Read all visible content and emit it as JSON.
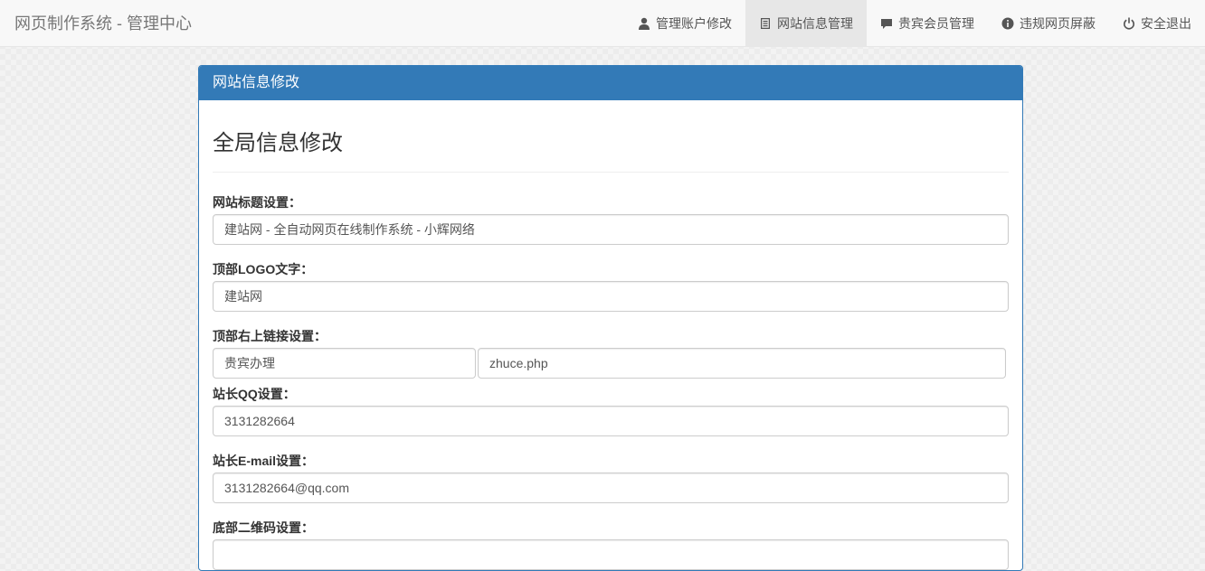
{
  "brand": "网页制作系统 - 管理中心",
  "nav": {
    "items": [
      {
        "label": "管理账户修改",
        "icon": "user-icon"
      },
      {
        "label": "网站信息管理",
        "icon": "list-icon",
        "active": true
      },
      {
        "label": "贵宾会员管理",
        "icon": "comment-icon"
      },
      {
        "label": "违规网页屏蔽",
        "icon": "info-icon"
      },
      {
        "label": "安全退出",
        "icon": "power-icon"
      }
    ]
  },
  "panel": {
    "heading": "网站信息修改",
    "section_title": "全局信息修改"
  },
  "form": {
    "site_title_label": "网站标题设置：",
    "site_title_value": "建站网 - 全自动网页在线制作系统 - 小辉网络",
    "logo_text_label": "顶部LOGO文字：",
    "logo_text_value": "建站网",
    "top_link_label": "顶部右上链接设置：",
    "top_link_text_value": "贵宾办理",
    "top_link_url_value": "zhuce.php",
    "qq_label": "站长QQ设置：",
    "qq_value": "3131282664",
    "email_label": "站长E-mail设置：",
    "email_value": "3131282664@qq.com",
    "qrcode_label": "底部二维码设置："
  },
  "colors": {
    "primary": "#337ab7",
    "navbar_bg": "#f8f8f8",
    "active_nav_bg": "#e7e7e7"
  }
}
